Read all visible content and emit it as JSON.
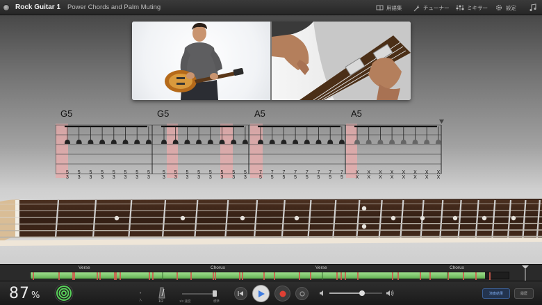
{
  "header": {
    "title": "Rock Guitar 1",
    "subtitle": "Power Chords and Palm Muting",
    "buttons": [
      {
        "label": "用語集",
        "icon": "book-icon"
      },
      {
        "label": "チューナー",
        "icon": "tuning-fork-icon"
      },
      {
        "label": "ミキサー",
        "icon": "mixer-sliders-icon"
      },
      {
        "label": "設定",
        "icon": "gear-icon"
      },
      {
        "label": "",
        "icon": "music-note-icon"
      }
    ]
  },
  "notation": {
    "chords": [
      "G5",
      "G5",
      "A5",
      "A5"
    ],
    "tab_numbers": [
      "5",
      "3",
      "7",
      "5",
      "X"
    ]
  },
  "song_sections": [
    "Verse",
    "Chorus",
    "Verse",
    "Chorus"
  ],
  "progress": {
    "fraction": 0.95
  },
  "score": {
    "value": "87",
    "unit": "%"
  },
  "controls": {
    "metronome_label": "入",
    "count_in_label": "1/2",
    "tempo_slow_label": "1/2 速度",
    "tempo_fast_label": "標準",
    "buttons": [
      "skip-back-button",
      "play-button",
      "record-button",
      "cycle-button"
    ],
    "volume": 0.62,
    "right_buttons": [
      "演奏結果",
      "履歴"
    ]
  },
  "colors": {
    "accent": "#3d7be0",
    "record": "#e04034",
    "progress_green": "#7ed06b",
    "highlight": "#e6aaaa"
  }
}
